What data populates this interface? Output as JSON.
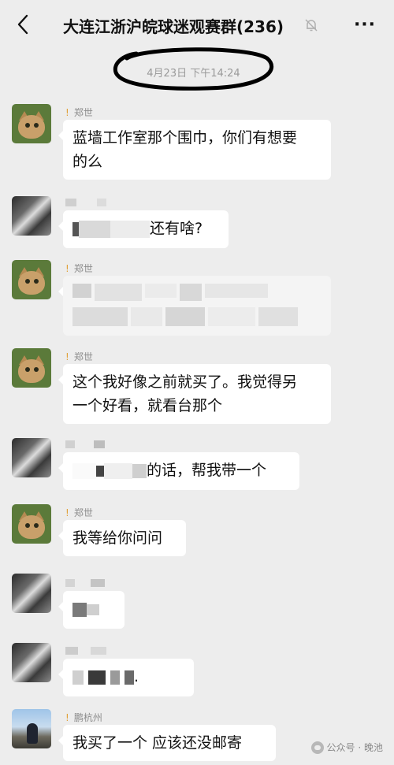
{
  "header": {
    "title": "大连江浙沪皖球迷观赛群(236)",
    "more_label": "···"
  },
  "timestamp": "4月23日 下午14:24",
  "messages": [
    {
      "sender": "郑世",
      "avatar": "cat-icon",
      "text": [
        "蓝墙工作室那个围巾，你们有想要",
        "的么"
      ]
    },
    {
      "sender": "",
      "avatar": "blurred-avatar",
      "text": [
        "还有啥?"
      ]
    },
    {
      "sender": "郑世",
      "avatar": "cat-icon",
      "text": []
    },
    {
      "sender": "郑世",
      "avatar": "cat-icon",
      "text": [
        "这个我好像之前就买了。我觉得另",
        "一个好看，就看台那个"
      ]
    },
    {
      "sender": "",
      "avatar": "blurred-avatar",
      "text": [
        "的话，帮我带一个"
      ]
    },
    {
      "sender": "郑世",
      "avatar": "cat-icon",
      "text": [
        "我等给你问问"
      ]
    },
    {
      "sender": "",
      "avatar": "blurred-avatar",
      "text": []
    },
    {
      "sender": "",
      "avatar": "blurred-avatar",
      "text": [
        "."
      ]
    },
    {
      "sender": "鹏杭州",
      "avatar": "person-photo",
      "text": [
        "我买了一个 应该还没邮寄"
      ]
    }
  ],
  "watermark": "公众号 · 晚池",
  "icons": {
    "back": "chevron-left-icon",
    "mute": "bell-muted-icon",
    "more": "more-icon",
    "watermark": "wechat-icon"
  }
}
